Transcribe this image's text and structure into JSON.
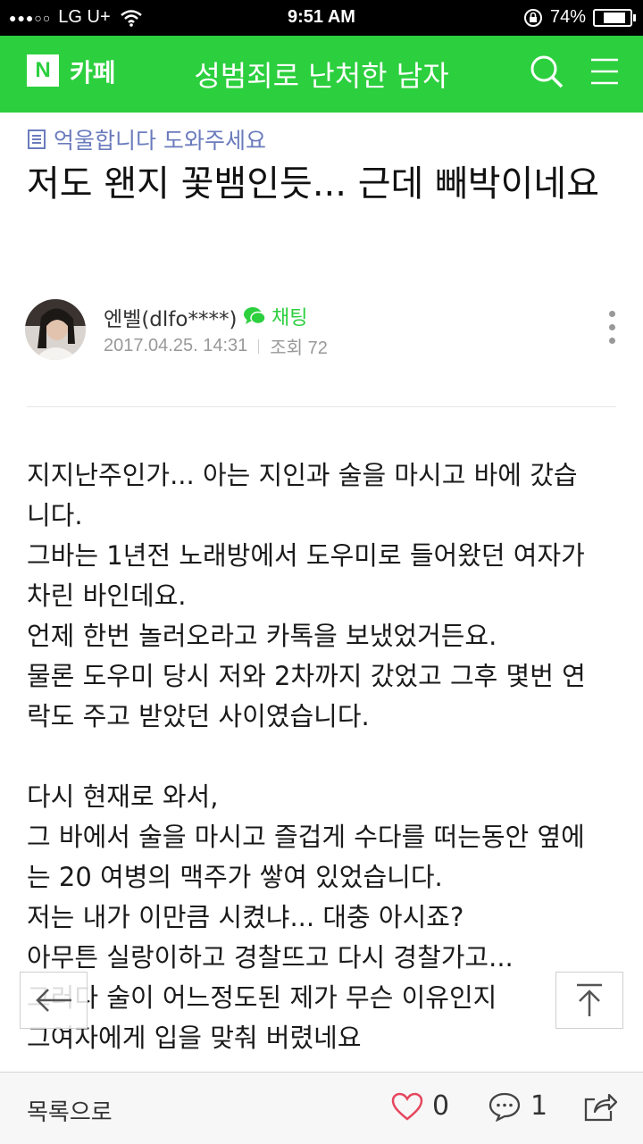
{
  "status_bar": {
    "carrier": "LG U+",
    "time": "9:51 AM",
    "battery": "74%",
    "battery_level": 0.74
  },
  "header": {
    "logo_letter": "N",
    "logo_text": "카페",
    "title": "성범죄로 난처한 남자"
  },
  "post": {
    "category": "억울합니다 도와주세요",
    "title": "저도 왠지 꽃뱀인듯... 근데 빼박이네요",
    "author": "엔벨(dlfo****)",
    "chat_label": "채팅",
    "date": "2017.04.25. 14:31",
    "views": "조회 72",
    "body_lines": [
      "지지난주인가... 아는 지인과 술을 마시고 바에 갔습",
      "니다.",
      "그바는 1년전 노래방에서 도우미로 들어왔던 여자가",
      "차린 바인데요.",
      "언제 한번 놀러오라고 카톡을 보냈었거든요.",
      "물론 도우미 당시 저와 2차까지 갔었고 그후 몇번 연",
      "락도 주고 받았던 사이였습니다.",
      "",
      "다시 현재로 와서,",
      "그 바에서 술을 마시고 즐겁게 수다를 떠는동안 옆에",
      "는 20 여병의 맥주가 쌓여 있었습니다.",
      "저는 내가 이만큼 시켰냐... 대충 아시죠?",
      "아무튼 실랑이하고 경찰뜨고 다시 경찰가고...",
      "그러다 술이 어느정도된 제가 무슨 이유인지",
      "그여자에게 입을 맞춰 버렸네요"
    ]
  },
  "bottom_bar": {
    "list_label": "목록으로",
    "like_count": "0",
    "comment_count": "1"
  },
  "colors": {
    "brand_green": "#2ccf3e",
    "category_blue": "#6a7bbd"
  },
  "icons": [
    "wifi-icon",
    "lock-rotation-icon",
    "battery-icon",
    "search-icon",
    "menu-icon",
    "category-icon",
    "chat-icon",
    "more-icon",
    "back-arrow-icon",
    "scroll-top-icon",
    "heart-icon",
    "comment-icon",
    "share-icon"
  ]
}
